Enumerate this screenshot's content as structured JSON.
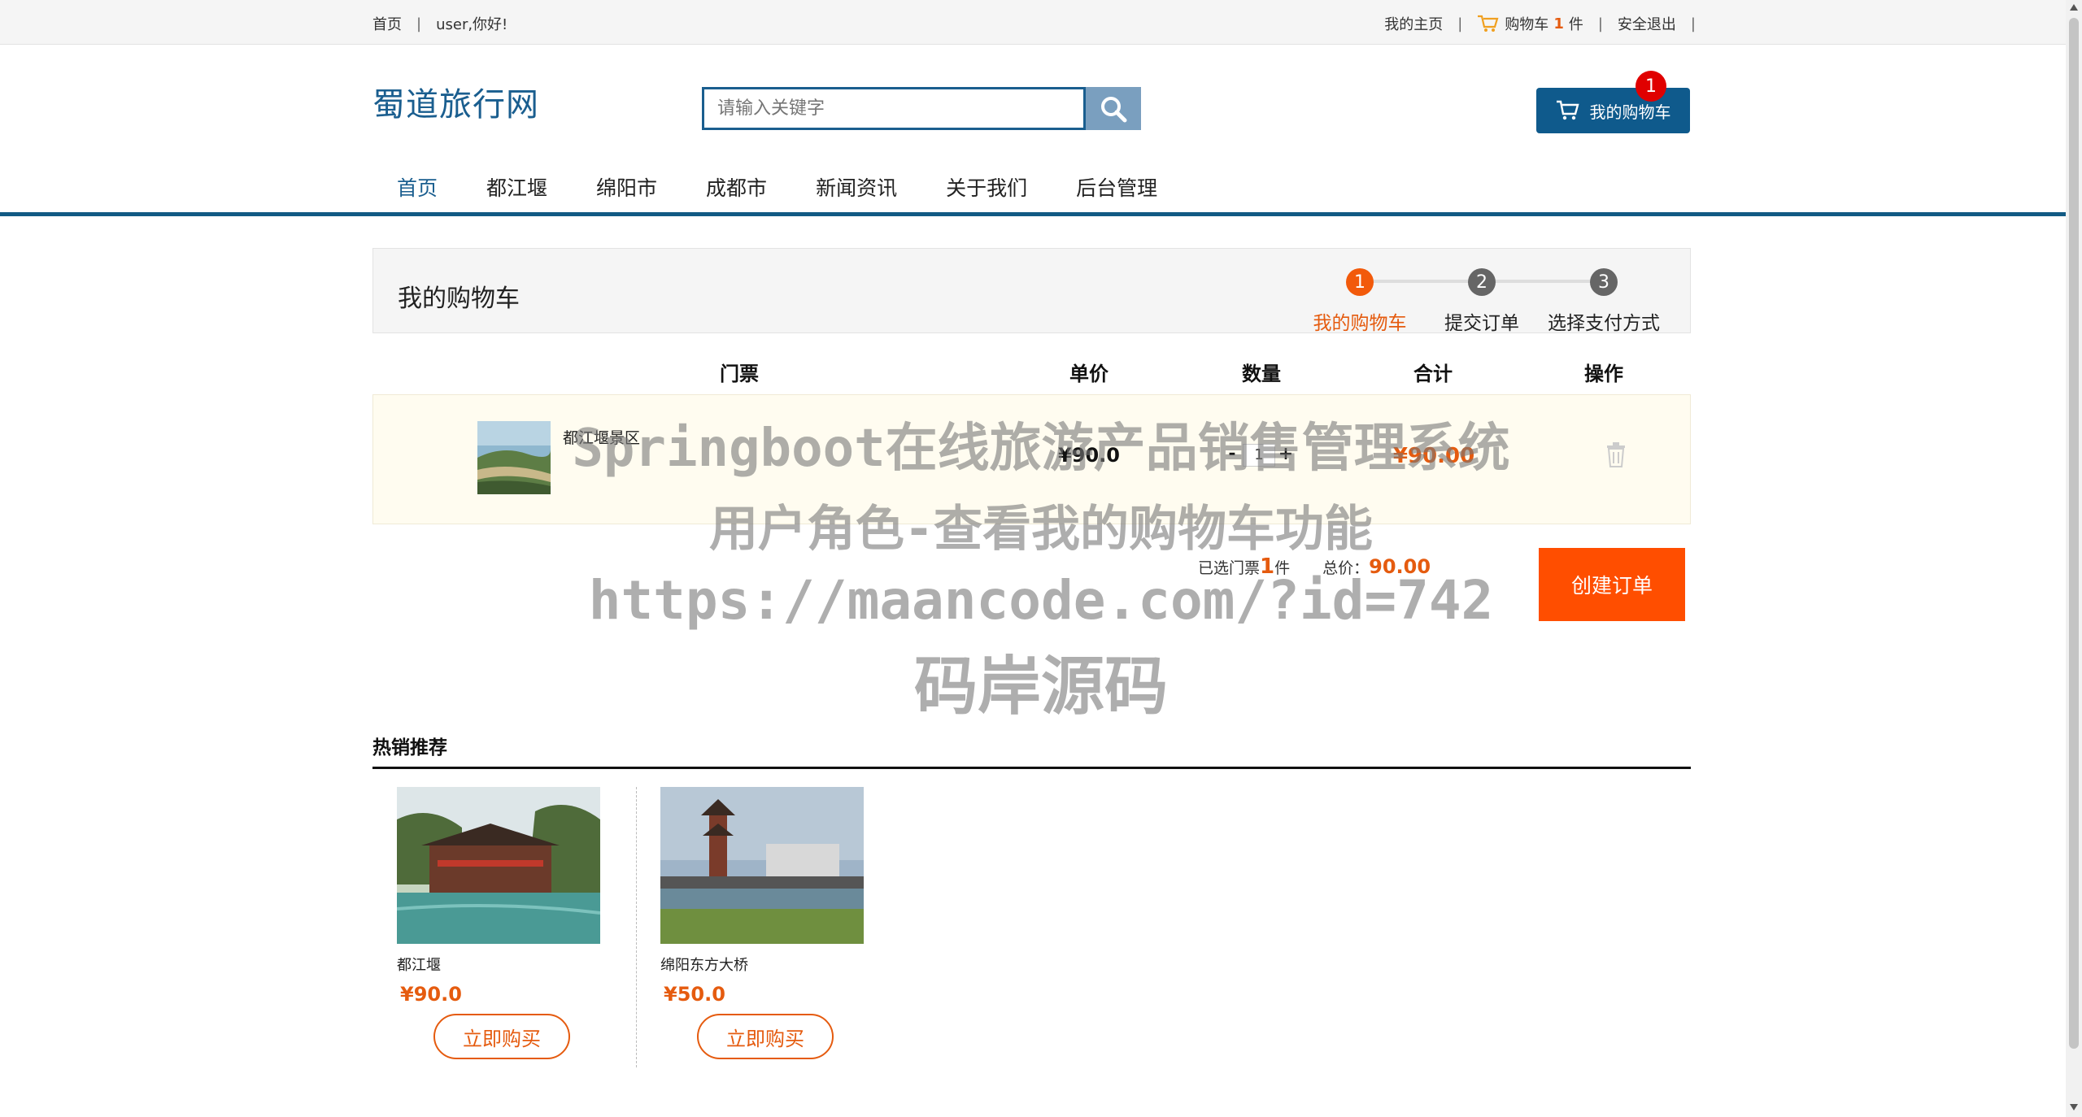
{
  "topbar": {
    "home": "首页",
    "greeting": "user,你好!",
    "my_home": "我的主页",
    "cart_label": "购物车",
    "cart_count": "1",
    "cart_unit": "件",
    "logout": "安全退出"
  },
  "header": {
    "logo": "蜀道旅行网",
    "search_placeholder": "请输入关键字",
    "cart_button": "我的购物车",
    "cart_badge": "1"
  },
  "nav": {
    "items": [
      "首页",
      "都江堰",
      "绵阳市",
      "成都市",
      "新闻资讯",
      "关于我们",
      "后台管理"
    ],
    "active_index": 0
  },
  "cart_panel": {
    "title": "我的购物车",
    "steps": [
      {
        "num": "1",
        "label": "我的购物车",
        "active": true
      },
      {
        "num": "2",
        "label": "提交订单",
        "active": false
      },
      {
        "num": "3",
        "label": "选择支付方式",
        "active": false
      }
    ]
  },
  "table": {
    "headers": [
      "门票",
      "单价",
      "数量",
      "合计",
      "操作"
    ],
    "rows": [
      {
        "name": "都江堰景区",
        "price": "¥90.0",
        "qty": "1",
        "minus": "-",
        "plus": "+",
        "total": "¥90.00"
      }
    ]
  },
  "summary": {
    "selected_prefix": "已选门票",
    "selected_count": "1",
    "selected_unit": "件",
    "total_label": "总价：",
    "total_value": "90.00",
    "create_order": "创建订单"
  },
  "watermark": {
    "line1": "Springboot在线旅游产品销售管理系统",
    "line2": "用户角色-查看我的购物车功能",
    "line3": "https://maancode.com/?id=742",
    "line4": "码岸源码"
  },
  "hot": {
    "title": "热销推荐",
    "items": [
      {
        "name": "都江堰",
        "price": "¥90.0",
        "buy": "立即购买"
      },
      {
        "name": "绵阳东方大桥",
        "price": "¥50.0",
        "buy": "立即购买"
      }
    ]
  },
  "colors": {
    "brand": "#1a5e8f",
    "accent": "#e55b0f",
    "order_button": "#ff4e00"
  }
}
